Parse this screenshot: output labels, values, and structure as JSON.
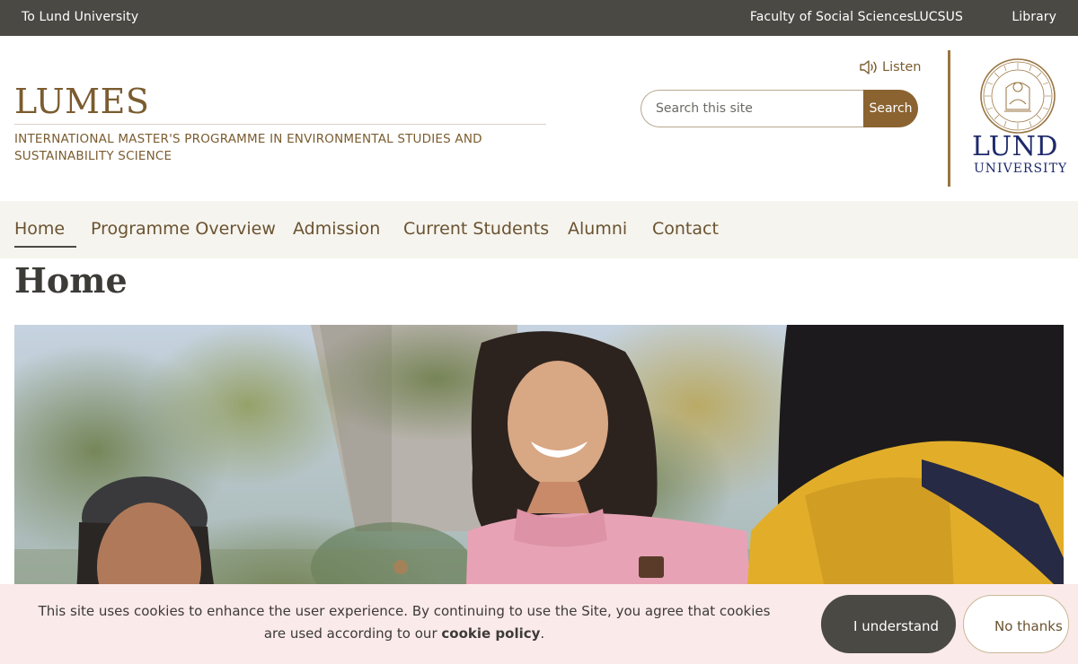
{
  "topbar": {
    "home_link": "To Lund University",
    "links": [
      "Faculty of Social Sciences",
      "LUCSUS",
      "Library"
    ]
  },
  "header": {
    "title": "LUMES",
    "subtitle": "INTERNATIONAL MASTER'S PROGRAMME IN ENVIRONMENTAL STUDIES AND SUSTAINABILITY SCIENCE",
    "listen_label": "Listen",
    "search_placeholder": "Search this site",
    "search_button": "Search",
    "logo_line1": "LUND",
    "logo_line2": "UNIVERSITY"
  },
  "nav": {
    "items": [
      "Home",
      "Programme Overview",
      "Admission",
      "Current Students",
      "Alumni",
      "Contact"
    ],
    "active": "Home"
  },
  "page": {
    "title": "Home"
  },
  "cookie": {
    "text_before": "This site uses cookies to enhance the user experience. By continuing to use the Site, you agree that cookies are used according to our ",
    "link": "cookie policy",
    "text_after": ".",
    "accept_label": "I understand",
    "decline_label": "No thanks"
  },
  "colors": {
    "topbar": "#4a4944",
    "brand_brown": "#7b5c2f",
    "search_button": "#8b6331",
    "lund_blue": "#1f2a6b",
    "cookie_bg": "#fbeaea"
  }
}
